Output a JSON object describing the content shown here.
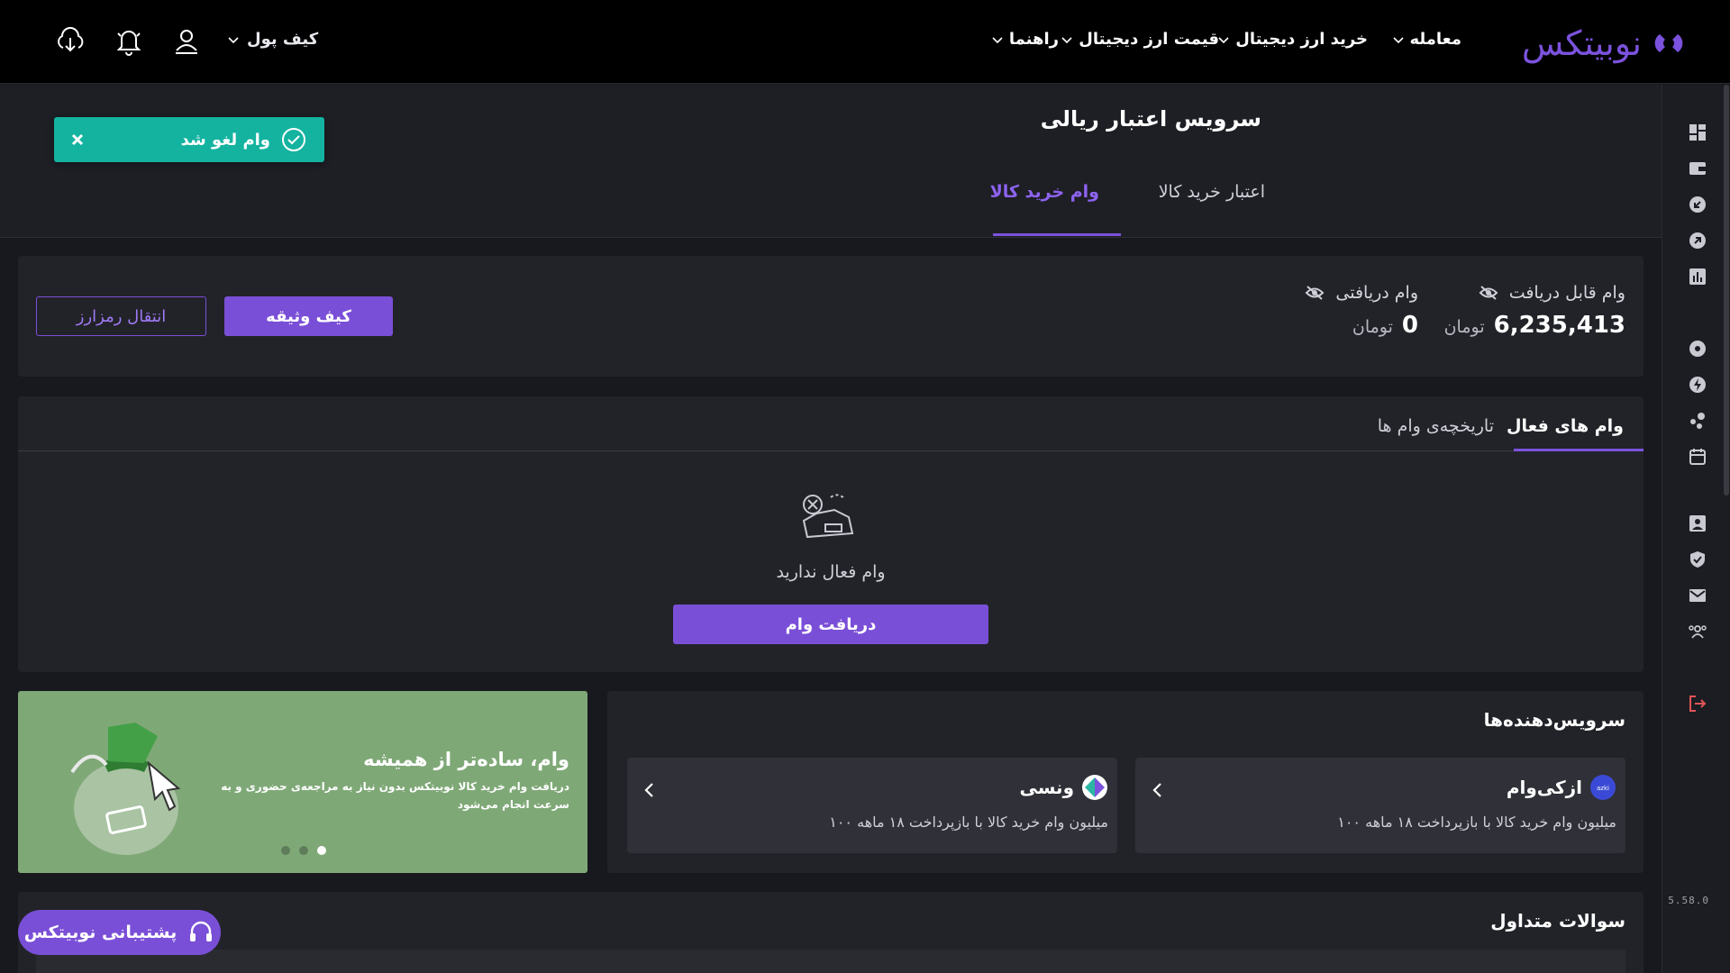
{
  "app": {
    "logo_text": "نوبیتکس"
  },
  "nav": {
    "items": [
      {
        "label": "معامله"
      },
      {
        "label": "خرید ارز دیجیتال"
      },
      {
        "label": "قیمت ارز دیجیتال"
      },
      {
        "label": "راهنما"
      }
    ],
    "wallet_label": "کیف پول"
  },
  "header": {
    "title": "سرویس اعتبار ریالی",
    "tabs": [
      {
        "label": "اعتبار خرید کالا",
        "active": false
      },
      {
        "label": "وام خرید کالا",
        "active": true
      }
    ]
  },
  "toast": {
    "message": "وام لغو شد"
  },
  "summary": {
    "eligible_label": "وام قابل دریافت",
    "eligible_value": "6,235,413",
    "received_label": "وام دریافتی",
    "received_value": "0",
    "unit": "تومان",
    "collateral_button": "کیف وثیقه",
    "transfer_button": "انتقال رمزارز"
  },
  "loans": {
    "tabs": [
      {
        "label": "وام های فعال",
        "active": true
      },
      {
        "label": "تاریخچه‌ی وام ها",
        "active": false
      }
    ],
    "empty_text": "وام فعال ندارید",
    "get_loan_button": "دریافت وام"
  },
  "providers": {
    "title": "سرویس‌دهنده‌ها",
    "items": [
      {
        "name": "ازکی‌وام",
        "desc": "۱۰۰ میلیون وام خرید کالا با بازپرداخت ۱۸ ماهه"
      },
      {
        "name": "ونسی",
        "desc": "۱۰۰ میلیون وام خرید کالا با بازپرداخت ۱۸ ماهه"
      }
    ]
  },
  "banner": {
    "title": "وام، ساده‌تر از همیشه",
    "subtitle": "دریافت وام خرید کالا نوبیتکس بدون نیاز به مراجعه‌ی حضوری و به سرعت انجام می‌شود",
    "slide_count": 3,
    "active_slide": 1
  },
  "faq": {
    "title": "سوالات متداول"
  },
  "support": {
    "label": "پشتیبانی نوبیتکس"
  },
  "version": "5.58.0",
  "colors": {
    "accent": "#7a4fd7",
    "toast": "#14b3a0",
    "background": "#18191e",
    "logout": "#e05555"
  }
}
